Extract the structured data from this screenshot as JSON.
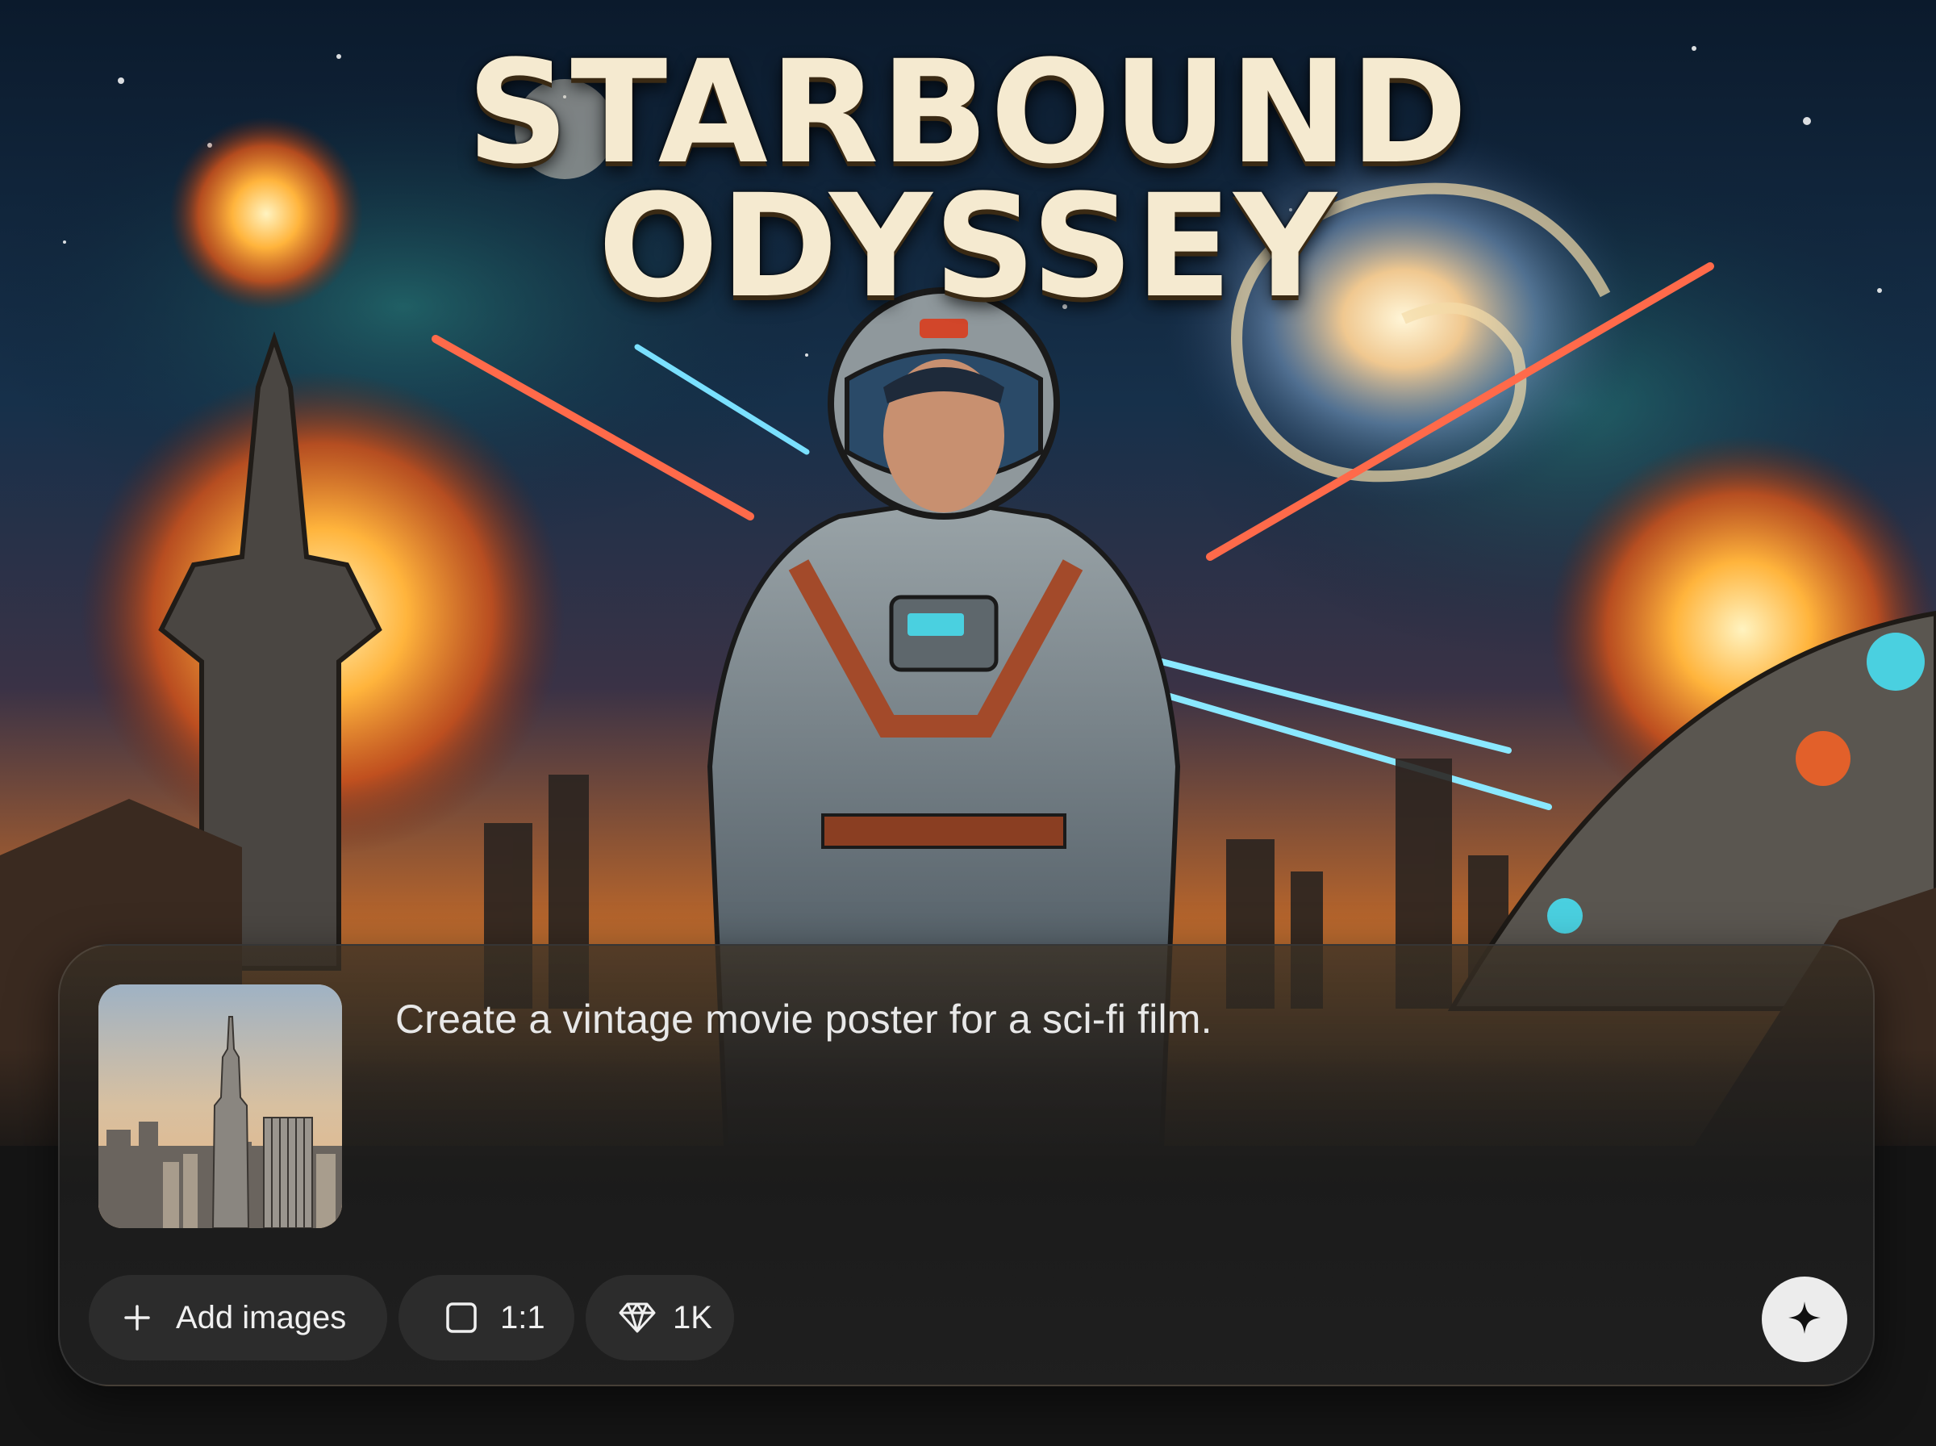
{
  "poster": {
    "title_line1": "STARBOUND",
    "title_line2": "ODYSSEY"
  },
  "composer": {
    "prompt_text": "Create a vintage movie poster for a sci-fi film.",
    "attachment_icon": "city-skyline-thumbnail",
    "add_images_label": "Add images",
    "add_images_icon": "plus-icon",
    "aspect_ratio_label": "1:1",
    "aspect_ratio_icon": "square-icon",
    "quality_label": "1K",
    "quality_icon": "diamond-icon",
    "submit_icon": "sparkle-icon"
  },
  "colors": {
    "title": "#f5ead0",
    "chip_background": "#2c2c2c",
    "submit_background": "#ececec",
    "page_background": "#151515"
  }
}
